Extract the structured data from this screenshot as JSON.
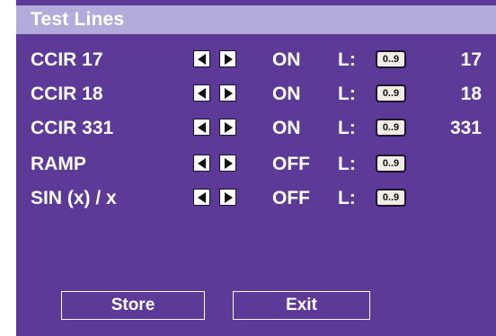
{
  "window": {
    "title": "Test Lines"
  },
  "rows": [
    {
      "label": "CCIR 17",
      "state": "ON",
      "l_label": "L:",
      "range": "0..9",
      "value": "17"
    },
    {
      "label": "CCIR 18",
      "state": "ON",
      "l_label": "L:",
      "range": "0..9",
      "value": "18"
    },
    {
      "label": "CCIR 331",
      "state": "ON",
      "l_label": "L:",
      "range": "0..9",
      "value": "331"
    },
    {
      "label": "RAMP",
      "state": "OFF",
      "l_label": "L:",
      "range": "0..9",
      "value": ""
    },
    {
      "label": "SIN (x) / x",
      "state": "OFF",
      "l_label": "L:",
      "range": "0..9",
      "value": ""
    }
  ],
  "buttons": {
    "store": "Store",
    "exit": "Exit"
  },
  "colors": {
    "panel_background": "#5d3a97",
    "title_bar": "#b3acdb",
    "text": "#ffffff",
    "range_box": "#f2ede4"
  }
}
